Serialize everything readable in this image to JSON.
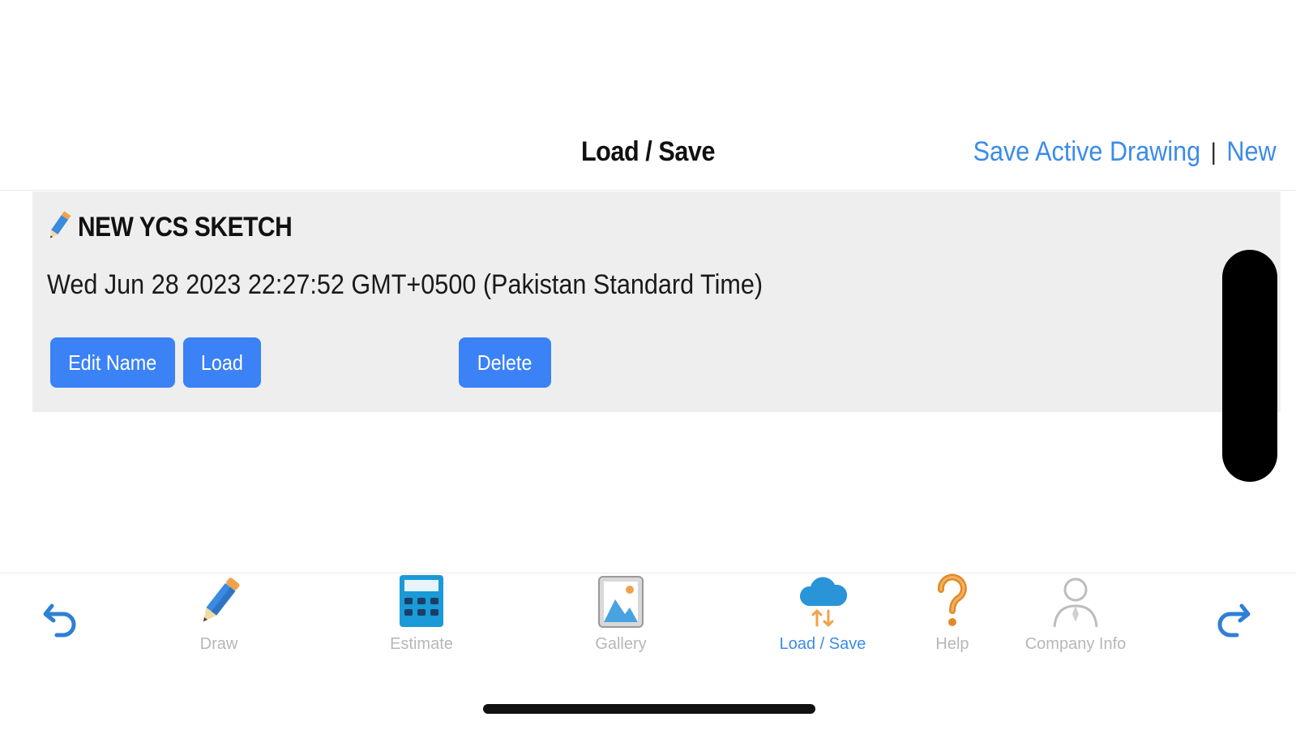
{
  "header": {
    "title": "Load / Save",
    "save_active_label": "Save Active Drawing",
    "separator": "|",
    "new_label": "New"
  },
  "drawing_list": [
    {
      "name": "NEW YCS SKETCH",
      "date": "Wed Jun 28 2023 22:27:52 GMT+0500 (Pakistan Standard Time)",
      "edit_label": "Edit Name",
      "load_label": "Load",
      "delete_label": "Delete"
    }
  ],
  "tabbar": {
    "undo_icon": "undo-arrow-icon",
    "redo_icon": "redo-arrow-icon",
    "tabs": [
      {
        "label": "Draw",
        "icon": "pencil-icon",
        "active": false
      },
      {
        "label": "Estimate",
        "icon": "calculator-icon",
        "active": false
      },
      {
        "label": "Gallery",
        "icon": "gallery-image-icon",
        "active": false
      },
      {
        "label": "Load / Save",
        "icon": "cloud-sync-icon",
        "active": true
      },
      {
        "label": "Help",
        "icon": "question-mark-icon",
        "active": false
      },
      {
        "label": "Company Info",
        "icon": "person-icon",
        "active": false
      }
    ]
  },
  "colors": {
    "accent": "#3b8beb",
    "button": "#3a82f5",
    "card_bg": "#eeeeee",
    "inactive_label": "#b7b7b7"
  }
}
